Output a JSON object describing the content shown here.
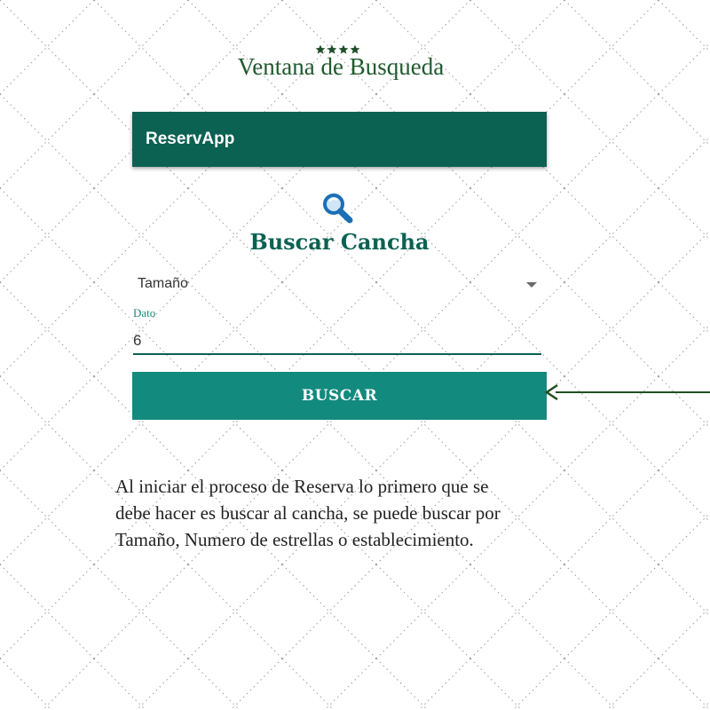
{
  "header": {
    "rating_icons": [
      "star-icon",
      "star-icon",
      "star-icon",
      "star-icon"
    ],
    "title": "Ventana de Busqueda"
  },
  "app": {
    "app_bar_title": "ReservApp",
    "search_icon": "magnifier-icon",
    "screen_title": "Buscar Cancha",
    "size_select": {
      "selected": "Tamaño"
    },
    "data_field": {
      "label": "Dato",
      "value": "6"
    },
    "search_button_label": "BUSCAR"
  },
  "description": {
    "lines": [
      "Al iniciar el proceso de Reserva lo primero que se",
      "debe hacer es buscar al cancha, se puede buscar por",
      "Tamaño, Numero de estrellas o establecimiento."
    ]
  },
  "colors": {
    "app_bar": "#0b6152",
    "button": "#138a7e",
    "title_green": "#1f5a2e",
    "arrow": "#1f4f1f"
  }
}
